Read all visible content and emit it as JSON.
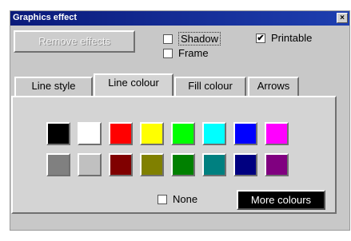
{
  "window": {
    "title": "Graphics effect",
    "close_glyph": "×"
  },
  "top": {
    "remove_effects_label": "Remove effects",
    "shadow": {
      "label": "Shadow",
      "checked": false
    },
    "frame": {
      "label": "Frame",
      "checked": false
    },
    "printable": {
      "label": "Printable",
      "checked": true,
      "mark": "✔"
    }
  },
  "tabs": [
    {
      "label": "Line style",
      "active": false
    },
    {
      "label": "Line colour",
      "active": true
    },
    {
      "label": "Fill colour",
      "active": false
    },
    {
      "label": "Arrows",
      "active": false
    }
  ],
  "palette": {
    "row1": [
      "#000000",
      "#ffffff",
      "#ff0000",
      "#ffff00",
      "#00ff00",
      "#00ffff",
      "#0000ff",
      "#ff00ff"
    ],
    "row2": [
      "#808080",
      "#c0c0c0",
      "#800000",
      "#808000",
      "#008000",
      "#008080",
      "#000080",
      "#800080"
    ]
  },
  "bottom": {
    "none": {
      "label": "None",
      "checked": false
    },
    "more_colours_label": "More colours"
  }
}
